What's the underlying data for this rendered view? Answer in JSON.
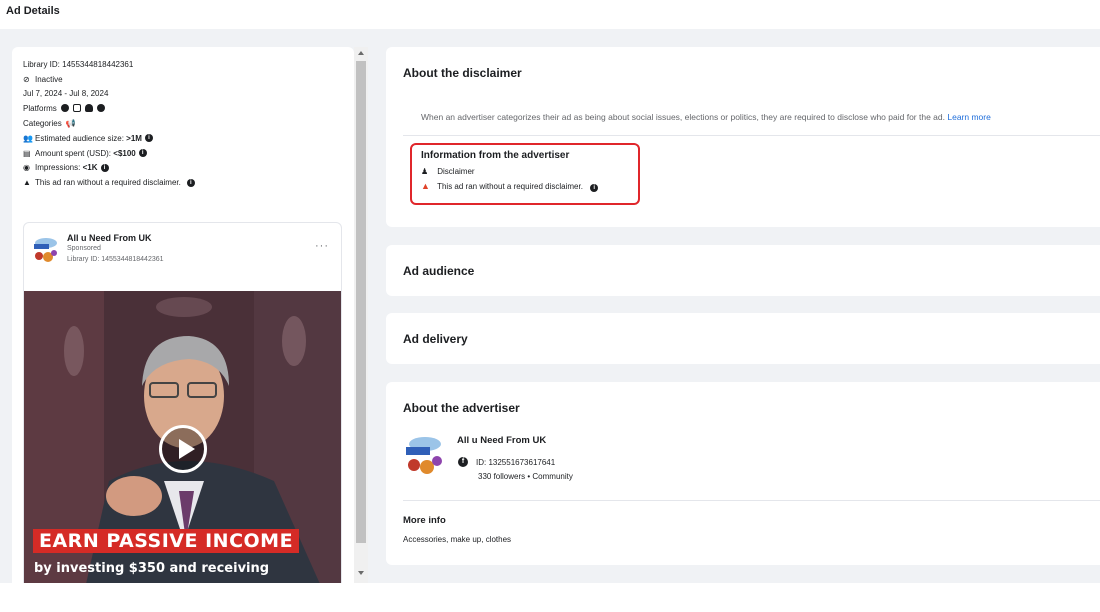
{
  "header": {
    "title": "Ad Details"
  },
  "ad_meta": {
    "library_id": "Library ID: 1455344818442361",
    "status": "Inactive",
    "date_range": "Jul 7, 2024 - Jul 8, 2024",
    "platforms_label": "Platforms",
    "categories_label": "Categories",
    "audience_label": "Estimated audience size:",
    "audience_value": ">1M",
    "spent_label": "Amount spent (USD):",
    "spent_value": "<$100",
    "impressions_label": "Impressions:",
    "impressions_value": "<1K",
    "warning": "This ad ran without a required disclaimer."
  },
  "ad_preview": {
    "page_name": "All u Need From UK",
    "sponsored": "Sponsored",
    "library_id": "Library ID: 1455344818442361",
    "more_label": "···",
    "headline": "EARN PASSIVE INCOME",
    "subline": "by investing $350 and receiving"
  },
  "disclaimer": {
    "title": "About the disclaimer",
    "text": "When an advertiser categorizes their ad as being about social issues, elections or politics, they are required to disclose who paid for the ad.",
    "learn_more": "Learn more",
    "info_title": "Information from the advertiser",
    "info_disclaimer": "Disclaimer",
    "info_warning": "This ad ran without a required disclaimer."
  },
  "sections": {
    "audience": "Ad audience",
    "delivery": "Ad delivery"
  },
  "advertiser": {
    "title": "About the advertiser",
    "name": "All u Need From UK",
    "id": "ID: 132551673617641",
    "followers": "330 followers • Community",
    "more_info_label": "More info",
    "more_info_value": "Accessories, make up, clothes"
  },
  "colors": {
    "warning": "#e0432a",
    "highlight_box": "#e0262b",
    "link": "#216fdb",
    "earn_bg": "#d52b26"
  }
}
